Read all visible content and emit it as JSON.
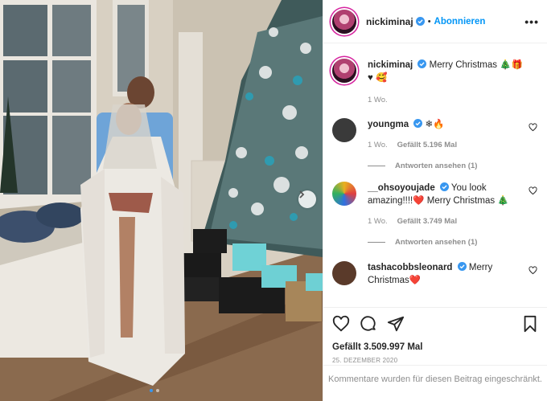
{
  "post": {
    "carousel": {
      "slides": 2,
      "active": 1
    },
    "next_icon": "chevron-right-icon"
  },
  "header": {
    "username": "nickiminaj",
    "separator": "•",
    "follow_label": "Abonnieren",
    "more_label": "•••"
  },
  "caption": {
    "username": "nickiminaj",
    "text": "Merry Christmas 🎄🎁♥ 🥰",
    "time": "1 Wo."
  },
  "comments": [
    {
      "username": "youngma",
      "text": "❄🔥",
      "time": "1 Wo.",
      "likes": "Gefällt 5.196 Mal",
      "replies": "Antworten ansehen (1)",
      "avatar_color": "#3a3a3a"
    },
    {
      "username": "__ohsoyoujade",
      "text": "You look amazing!!!!❤️ Merry Christmas 🎄",
      "time": "1 Wo.",
      "likes": "Gefällt 3.749 Mal",
      "replies": "Antworten ansehen (1)",
      "avatar_color": "#e8b020"
    },
    {
      "username": "tashacobbsleonard",
      "text": "Merry Christmas❤️",
      "avatar_color": "#5a3a2a"
    }
  ],
  "actions": {
    "likes": "Gefällt 3.509.997 Mal",
    "date": "25. DEZEMBER 2020",
    "comments_closed": "Kommentare wurden für diesen Beitrag eingeschränkt."
  },
  "colors": {
    "accent": "#0095f6",
    "verified": "#3897f0",
    "muted": "#8e8e8e"
  }
}
